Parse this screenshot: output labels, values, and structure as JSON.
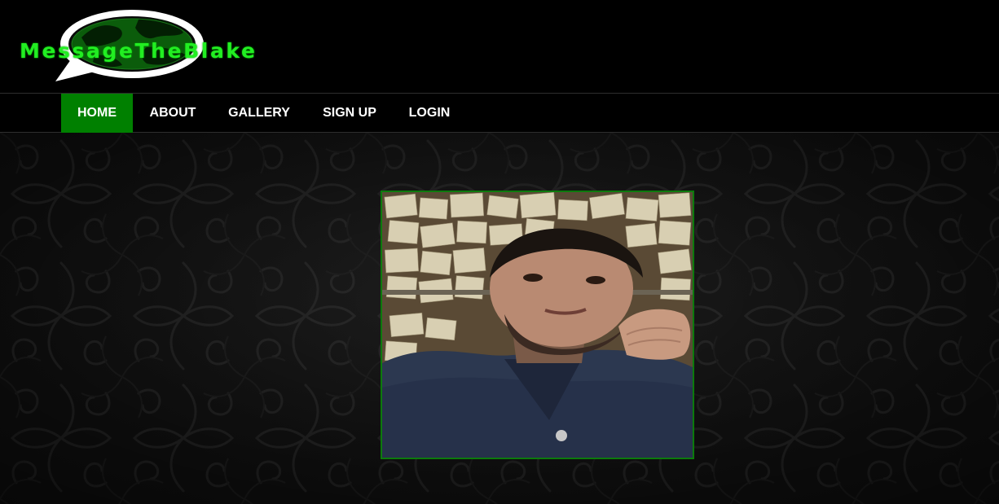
{
  "brand": {
    "name": "MessageTheBlake",
    "logo_icon": "globe-speech-bubble-icon",
    "text_color": "#22ee22"
  },
  "nav": {
    "items": [
      {
        "label": "HOME",
        "active": true
      },
      {
        "label": "ABOUT",
        "active": false
      },
      {
        "label": "GALLERY",
        "active": false
      },
      {
        "label": "SIGN UP",
        "active": false
      },
      {
        "label": "LOGIN",
        "active": false
      }
    ],
    "active_color": "#008000"
  },
  "hero": {
    "photo": "selfie-photo",
    "frame_color": "#0c7a0c"
  }
}
